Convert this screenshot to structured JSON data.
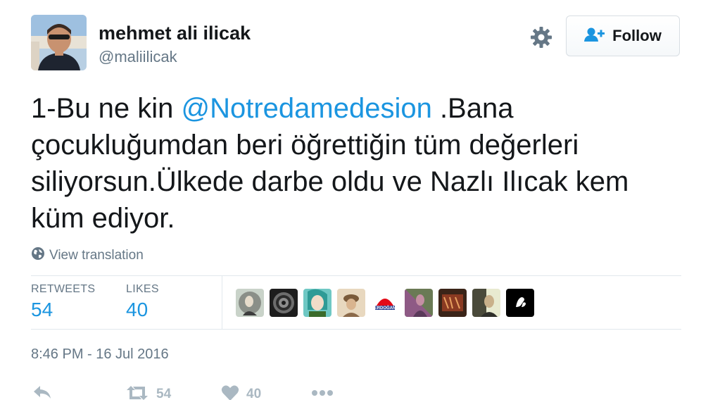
{
  "user": {
    "name": "mehmet ali ilicak",
    "handle": "@maliilicak"
  },
  "follow": {
    "label": "Follow"
  },
  "tweet": {
    "text_prefix": "1-Bu ne kin ",
    "mention": "@Notredamedesion",
    "text_suffix": " .Bana çocukluğumdan beri öğrettiğin tüm değerleri siliyorsun.Ülkede darbe oldu ve Nazlı Ilıcak kem küm ediyor."
  },
  "translation": {
    "label": "View translation"
  },
  "stats": {
    "retweets_label": "RETWEETS",
    "retweets_value": "54",
    "likes_label": "LIKES",
    "likes_value": "40"
  },
  "likers": {
    "erdogan_badge_text": "ERDOĞAN"
  },
  "timestamp": "8:46 PM - 16 Jul 2016",
  "actions": {
    "retweet_count": "54",
    "like_count": "40"
  },
  "colors": {
    "link": "#1b95e0",
    "muted": "#657786",
    "text": "#14171a",
    "action_gray": "#aab8c2"
  }
}
